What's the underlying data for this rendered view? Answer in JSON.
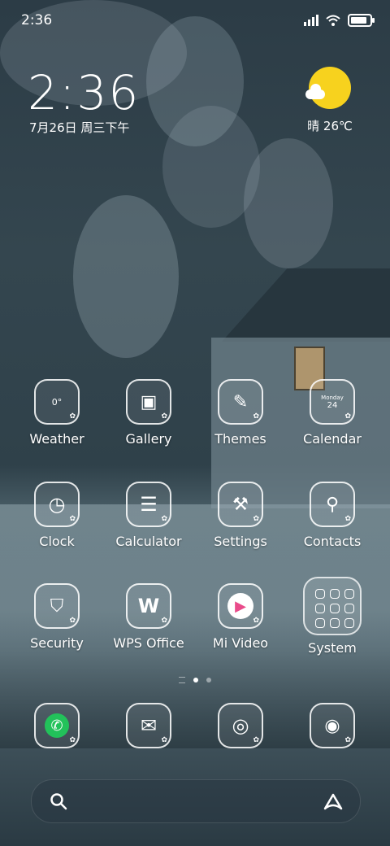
{
  "status_bar": {
    "time": "2:36",
    "battery_percent": 85
  },
  "clock_widget": {
    "time": "2:36",
    "date": "7月26日 周三下午"
  },
  "weather_widget": {
    "condition": "晴",
    "temperature": "26℃",
    "icon": "sunny-cloud-icon",
    "sun_color": "#f7d21e"
  },
  "apps": [
    {
      "label": "Weather",
      "icon": "weather-icon",
      "glyph": "0°"
    },
    {
      "label": "Gallery",
      "icon": "gallery-icon",
      "glyph": "▣"
    },
    {
      "label": "Themes",
      "icon": "themes-icon",
      "glyph": "✎"
    },
    {
      "label": "Calendar",
      "icon": "calendar-icon",
      "glyph": "Monday",
      "glyph2": "24"
    },
    {
      "label": "Clock",
      "icon": "clock-icon",
      "glyph": "◷"
    },
    {
      "label": "Calculator",
      "icon": "calculator-icon",
      "glyph": "☰"
    },
    {
      "label": "Settings",
      "icon": "settings-wrench-icon",
      "glyph": "⚒"
    },
    {
      "label": "Contacts",
      "icon": "contacts-icon",
      "glyph": "⚲"
    },
    {
      "label": "Security",
      "icon": "security-shield-icon",
      "glyph": "⛉"
    },
    {
      "label": "WPS Office",
      "icon": "wps-office-icon",
      "glyph": "W"
    },
    {
      "label": "Mi Video",
      "icon": "mi-video-icon",
      "glyph": "▶"
    },
    {
      "label": "System",
      "icon": "system-folder-icon"
    }
  ],
  "dock": [
    {
      "icon": "phone-icon",
      "glyph": "✆"
    },
    {
      "icon": "messages-icon",
      "glyph": "✉"
    },
    {
      "icon": "browser-planet-icon",
      "glyph": "◎"
    },
    {
      "icon": "camera-icon",
      "glyph": "◉"
    }
  ],
  "search_bar": {
    "left_icon": "search-icon",
    "right_icon": "assistant-icon"
  },
  "colors": {
    "phone_green": "#22c25a",
    "mi_video_gradient": [
      "#f5a623",
      "#e94b8a",
      "#4a7cf7"
    ]
  }
}
